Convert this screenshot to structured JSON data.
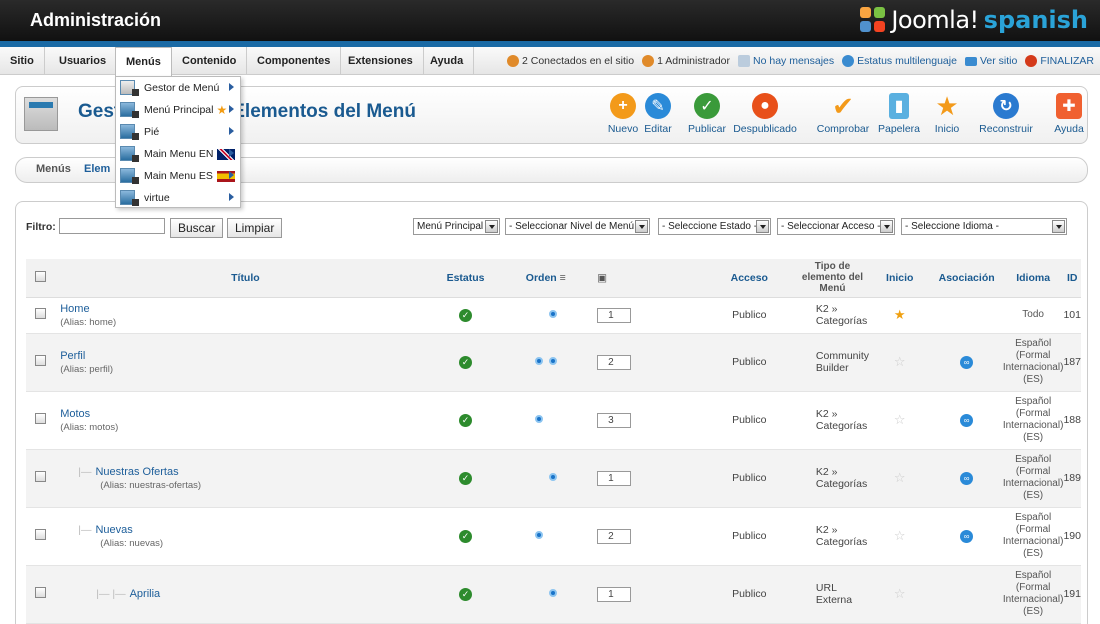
{
  "header": {
    "title": "Administración",
    "logo_text": "Joomla!",
    "logo_suffix": "spanish"
  },
  "menubar": {
    "items": [
      "Sitio",
      "Usuarios",
      "Menús",
      "Contenido",
      "Componentes",
      "Extensiones",
      "Ayuda"
    ],
    "active": "Menús",
    "status": {
      "online": "2 Conectados en el sitio",
      "admins": "1 Administrador",
      "messages": "No hay mensajes",
      "multilang": "Estatus multilenguaje",
      "view_site": "Ver sitio",
      "logout": "FINALIZAR"
    }
  },
  "dropdown": {
    "items": [
      {
        "label": "Gestor de Menú"
      },
      {
        "label": "Menú Principal",
        "star": true
      },
      {
        "label": "Pié"
      },
      {
        "label": "Main Menu EN",
        "flag": "uk"
      },
      {
        "label": "Main Menu ES",
        "flag": "es"
      },
      {
        "label": "virtue"
      }
    ]
  },
  "page": {
    "title_visible_start": "Gest",
    "title_visible_end": "Elementos del Menú"
  },
  "toolbar": {
    "new": "Nuevo",
    "edit": "Editar",
    "publish": "Publicar",
    "unpublish": "Despublicado",
    "check": "Comprobar",
    "trash": "Papelera",
    "home": "Inicio",
    "rebuild": "Reconstruir",
    "help": "Ayuda"
  },
  "subtabs": {
    "menus": "Menús",
    "items_partial": "Elem"
  },
  "filters": {
    "label": "Filtro:",
    "search": "Buscar",
    "clear": "Limpiar",
    "menu": "Menú Principal",
    "level": "- Seleccionar Nivel de Menú -",
    "state": "- Seleccione Estado -",
    "access": "- Seleccionar Acceso -",
    "language": "- Seleccione Idioma -"
  },
  "table": {
    "headers": {
      "title": "Título",
      "status": "Estatus",
      "order": "Orden",
      "access": "Acceso",
      "type": "Tipo de elemento del Menú",
      "home": "Inicio",
      "assoc": "Asociación",
      "lang": "Idioma",
      "id": "ID"
    },
    "rows": [
      {
        "title": "Home",
        "alias": "(Alias: home)",
        "level": 0,
        "order": "1",
        "up": false,
        "down": true,
        "access": "Publico",
        "type": "K2 » Categorías",
        "home": true,
        "assoc": false,
        "lang": "Todo",
        "id": "101"
      },
      {
        "title": "Perfil",
        "alias": "(Alias: perfil)",
        "level": 0,
        "order": "2",
        "up": true,
        "down": true,
        "access": "Publico",
        "type": "Community Builder",
        "home": false,
        "assoc": true,
        "lang": "Español (Formal Internacional) (ES)",
        "id": "187"
      },
      {
        "title": "Motos",
        "alias": "(Alias: motos)",
        "level": 0,
        "order": "3",
        "up": true,
        "down": false,
        "access": "Publico",
        "type": "K2 » Categorías",
        "home": false,
        "assoc": true,
        "lang": "Español (Formal Internacional) (ES)",
        "id": "188"
      },
      {
        "title": "Nuestras Ofertas",
        "alias": "(Alias: nuestras-ofertas)",
        "level": 1,
        "order": "1",
        "up": false,
        "down": true,
        "access": "Publico",
        "type": "K2 » Categorías",
        "home": false,
        "assoc": true,
        "lang": "Español (Formal Internacional) (ES)",
        "id": "189"
      },
      {
        "title": "Nuevas",
        "alias": "(Alias: nuevas)",
        "level": 1,
        "order": "2",
        "up": true,
        "down": false,
        "access": "Publico",
        "type": "K2 » Categorías",
        "home": false,
        "assoc": true,
        "lang": "Español (Formal Internacional) (ES)",
        "id": "190"
      },
      {
        "title": "Aprilia",
        "alias": "",
        "level": 2,
        "order": "1",
        "up": false,
        "down": true,
        "access": "Publico",
        "type": "URL Externa",
        "home": false,
        "assoc": false,
        "lang": "Español (Formal Internacional) (ES)",
        "id": "191"
      }
    ]
  }
}
